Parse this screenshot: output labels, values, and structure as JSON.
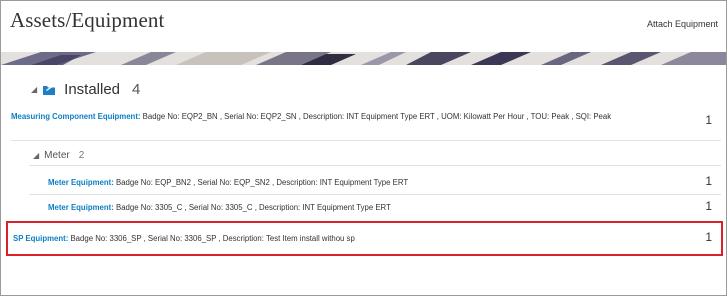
{
  "header": {
    "title": "Assets/Equipment",
    "attach_label": "Attach Equipment"
  },
  "installed": {
    "label": "Installed",
    "count": "4"
  },
  "rows": [
    {
      "link": "Measuring Component Equipment:",
      "details": " Badge No: EQP2_BN , Serial No: EQP2_SN , Description: INT Equipment Type ERT , UOM: Kilowatt Per Hour , TOU: Peak , SQI: Peak",
      "qty": "1"
    }
  ],
  "meter_group": {
    "label": "Meter",
    "count": "2",
    "rows": [
      {
        "link": "Meter Equipment:",
        "details": " Badge No: EQP_BN2 , Serial No: EQP_SN2 , Description: INT Equipment Type ERT",
        "qty": "1"
      },
      {
        "link": "Meter Equipment:",
        "details": " Badge No: 3305_C , Serial No: 3305_C , Description: INT Equipment Type ERT",
        "qty": "1"
      }
    ]
  },
  "sp_row": {
    "link": "SP Equipment:",
    "details": " Badge No: 3306_SP , Serial No: 3306_SP , Description: Test Item install withou sp",
    "qty": "1"
  },
  "colors": {
    "link": "#0d7ec4",
    "highlight_border": "#d8222b",
    "icon": "#1f7fc6"
  },
  "icons": {
    "installed_caret": "caret-down-icon",
    "installed_folder": "folder-icon",
    "meter_caret": "caret-down-icon"
  }
}
